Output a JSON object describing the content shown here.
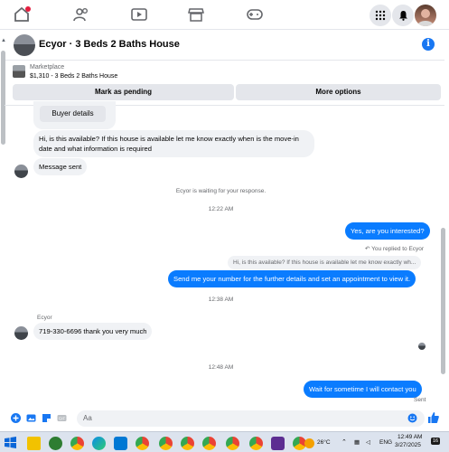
{
  "chat": {
    "title": "Ecyor · 3 Beds 2 Baths House"
  },
  "marketplace": {
    "label": "Marketplace",
    "price_line": "$1,310 - 3 Beds 2 Baths House",
    "mark_pending": "Mark as pending",
    "more_options": "More options"
  },
  "messages": {
    "buyer_details": "Buyer details",
    "in1": "Hi, is this available? If this house is available let me know exactly when is the move-in date and what information is required",
    "in2": "Message sent",
    "waiting": "Ecyor is waiting for your response.",
    "ts1": "12:22 AM",
    "out1": "Yes, are you interested?",
    "replied_to": "You replied to Ecyor",
    "quote": "Hi, is this available? If this house is available let me know exactly wh...",
    "out2": "Send me your number for the further details and set an appointment to view it.",
    "ts2": "12:38 AM",
    "sender_name": "Ecyor",
    "in3": "719-330-6696 thank you very much",
    "ts3": "12:48 AM",
    "out3": "Wait for sometime I will contact you",
    "sent": "Sent"
  },
  "composer": {
    "placeholder": "Aa"
  },
  "taskbar": {
    "temperature": "26°C",
    "language": "ENG",
    "time": "12:49 AM",
    "date": "3/27/2025",
    "badge": "16"
  },
  "colors": {
    "accent": "#1877f2",
    "outgoing_bubble": "#0a7cff",
    "incoming_bubble": "#f0f2f5"
  }
}
